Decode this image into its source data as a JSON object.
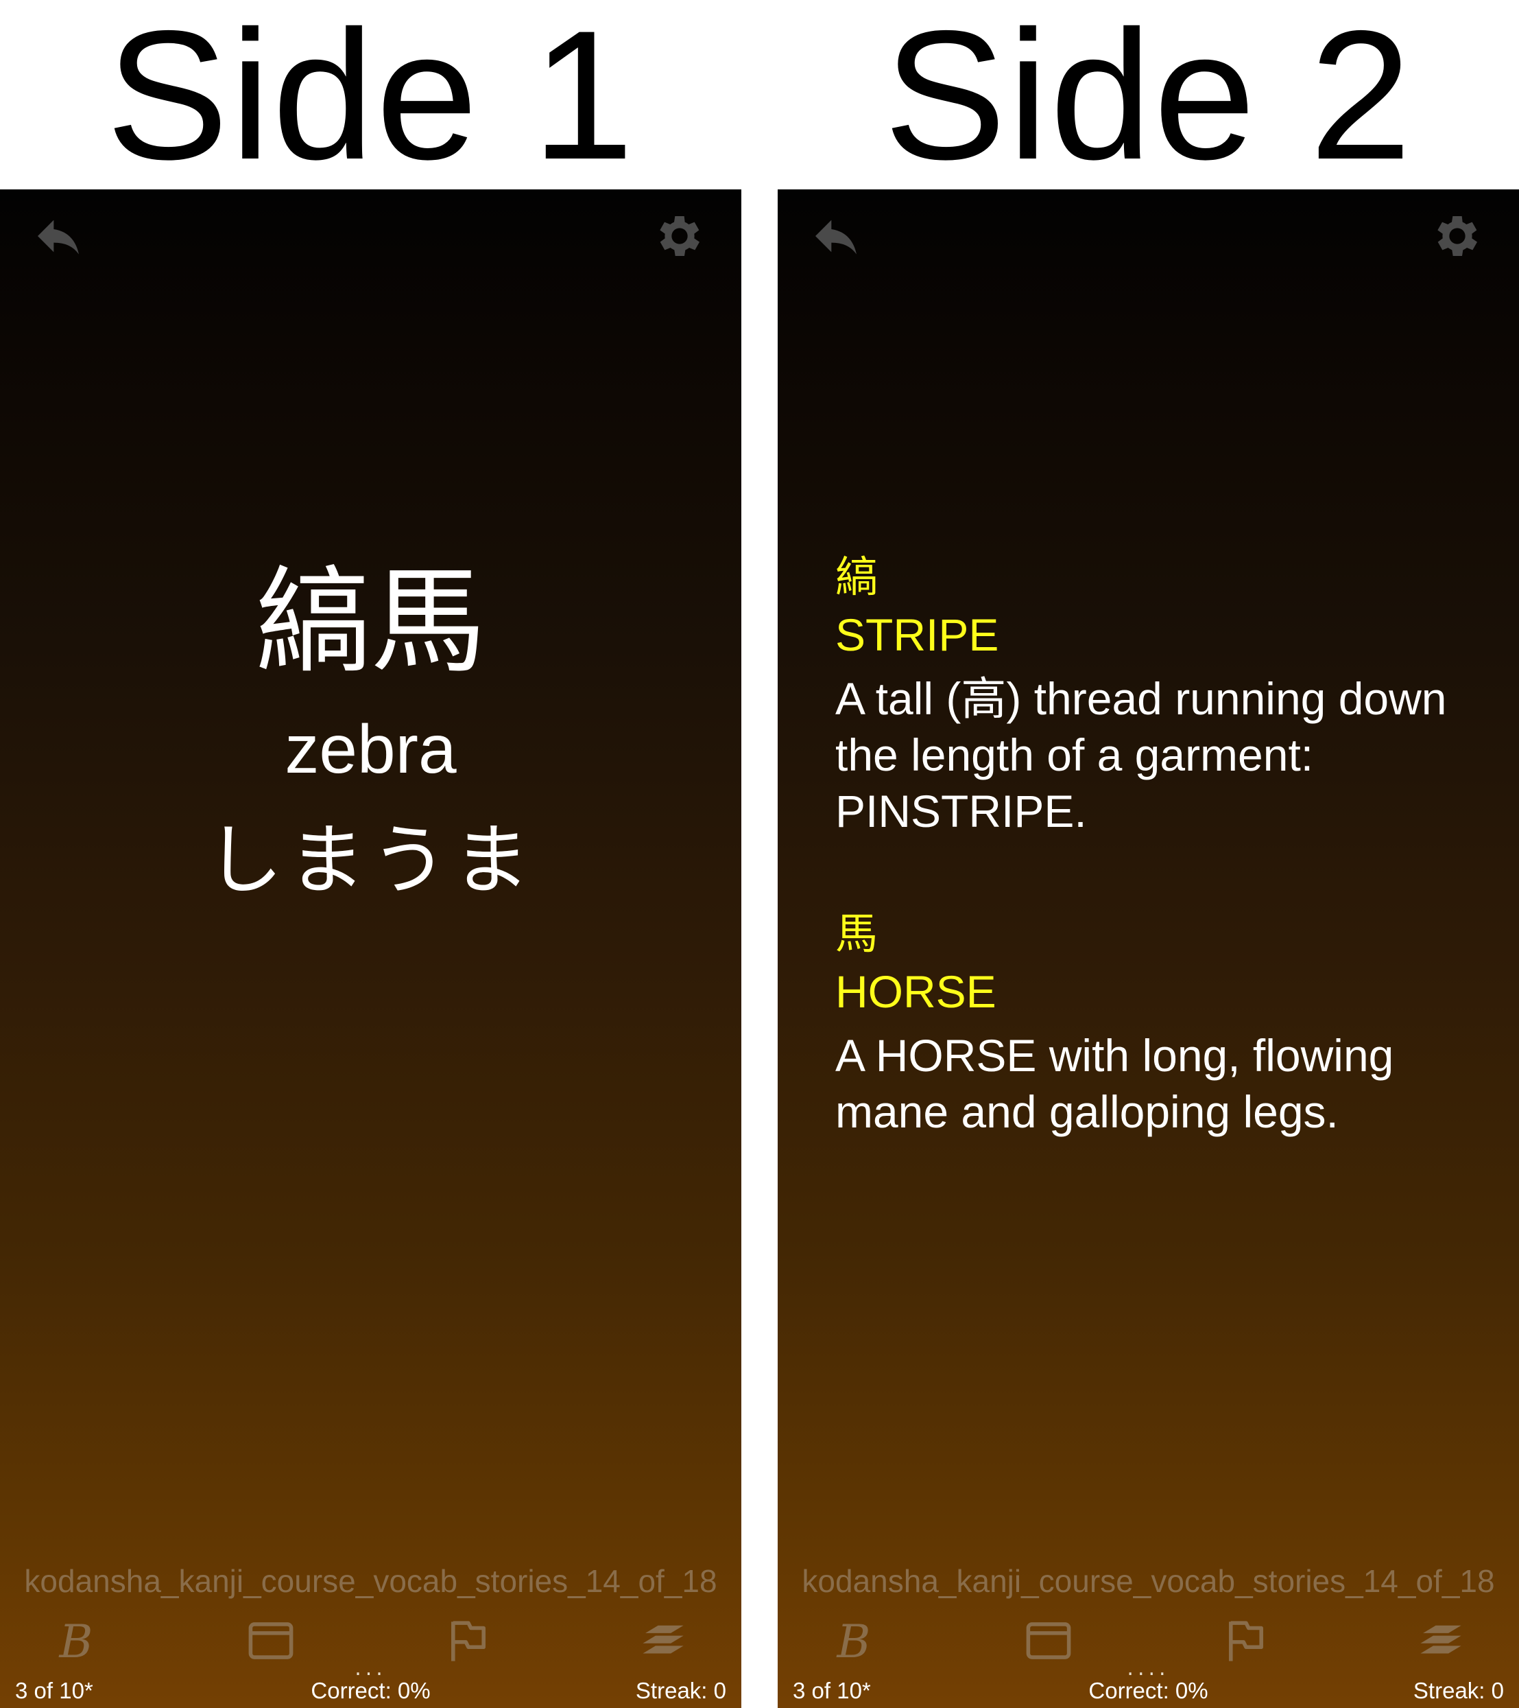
{
  "headings": {
    "side1": "Side 1",
    "side2": "Side 2"
  },
  "icons": {
    "back": "back-arrow-icon",
    "settings": "gear-icon",
    "bold": "bold-b-icon",
    "card": "card-icon",
    "flag": "flag-icon",
    "deck": "deck-stack-icon"
  },
  "colors": {
    "keyword": "#ffff1a",
    "deck_name": "#8a6d4a",
    "toolbar_icon": "#8a6d4a",
    "gradient_top": "#020202",
    "gradient_bottom": "#744003"
  },
  "side1": {
    "kanji": "縞馬",
    "meaning": "zebra",
    "reading": "しまうま",
    "deck_name": "kodansha_kanji_course_vocab_stories_14_of_18",
    "dots": "...",
    "status": {
      "count": "3 of 10*",
      "correct": "Correct: 0%",
      "streak": "Streak: 0"
    }
  },
  "side2": {
    "entries": [
      {
        "kanji": "縞",
        "keyword": "STRIPE",
        "story": "A tall (高) thread running down the length of a garment: PINSTRIPE."
      },
      {
        "kanji": "馬",
        "keyword": "HORSE",
        "story": "A HORSE with long, flowing mane and galloping legs."
      }
    ],
    "deck_name": "kodansha_kanji_course_vocab_stories_14_of_18",
    "dots": "....",
    "status": {
      "count": "3 of 10*",
      "correct": "Correct: 0%",
      "streak": "Streak: 0"
    }
  }
}
